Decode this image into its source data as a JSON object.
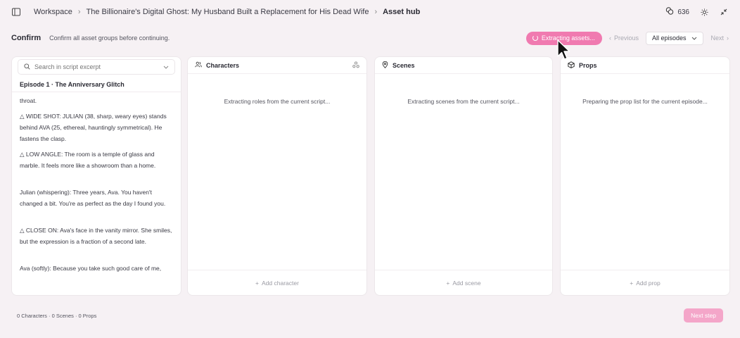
{
  "breadcrumb": {
    "workspace": "Workspace",
    "project": "The Billionaire's Digital Ghost: My Husband Built a Replacement for His Dead Wife",
    "current": "Asset hub"
  },
  "credits": "636",
  "confirm": {
    "title": "Confirm",
    "subtitle": "Confirm all asset groups before continuing.",
    "extract_label": "Extracting assets...",
    "prev_label": "Previous",
    "episode_select": "All episodes",
    "next_label": "Next"
  },
  "script": {
    "search_placeholder": "Search in script excerpt",
    "episode_title": "Episode 1 · The Anniversary Glitch",
    "lines": [
      "throat.",
      "△ WIDE SHOT: JULIAN (38, sharp, weary eyes) stands behind AVA (25, ethereal, hauntingly symmetrical). He fastens the clasp.",
      "△ LOW ANGLE: The room is a temple of glass and marble. It feels more like a showroom than a home.",
      "Julian (whispering): Three years, Ava. You haven't changed a bit. You're as perfect as the day I found you.",
      "△ CLOSE ON: Ava's face in the vanity mirror. She smiles, but the expression is a fraction of a second late.",
      "Ava (softly): Because you take such good care of me,"
    ]
  },
  "characters": {
    "title": "Characters",
    "message": "Extracting roles from the current script...",
    "add_label": "Add character"
  },
  "scenes": {
    "title": "Scenes",
    "message": "Extracting scenes from the current script...",
    "add_label": "Add scene"
  },
  "props": {
    "title": "Props",
    "message": "Preparing the prop list for the current episode...",
    "add_label": "Add prop"
  },
  "footer": {
    "summary": "0 Characters · 0 Scenes · 0 Props",
    "next_step": "Next step"
  },
  "colors": {
    "accent": "#f07ab0",
    "accent_disabled": "#f4a6c9",
    "background": "#f6f1f4"
  }
}
